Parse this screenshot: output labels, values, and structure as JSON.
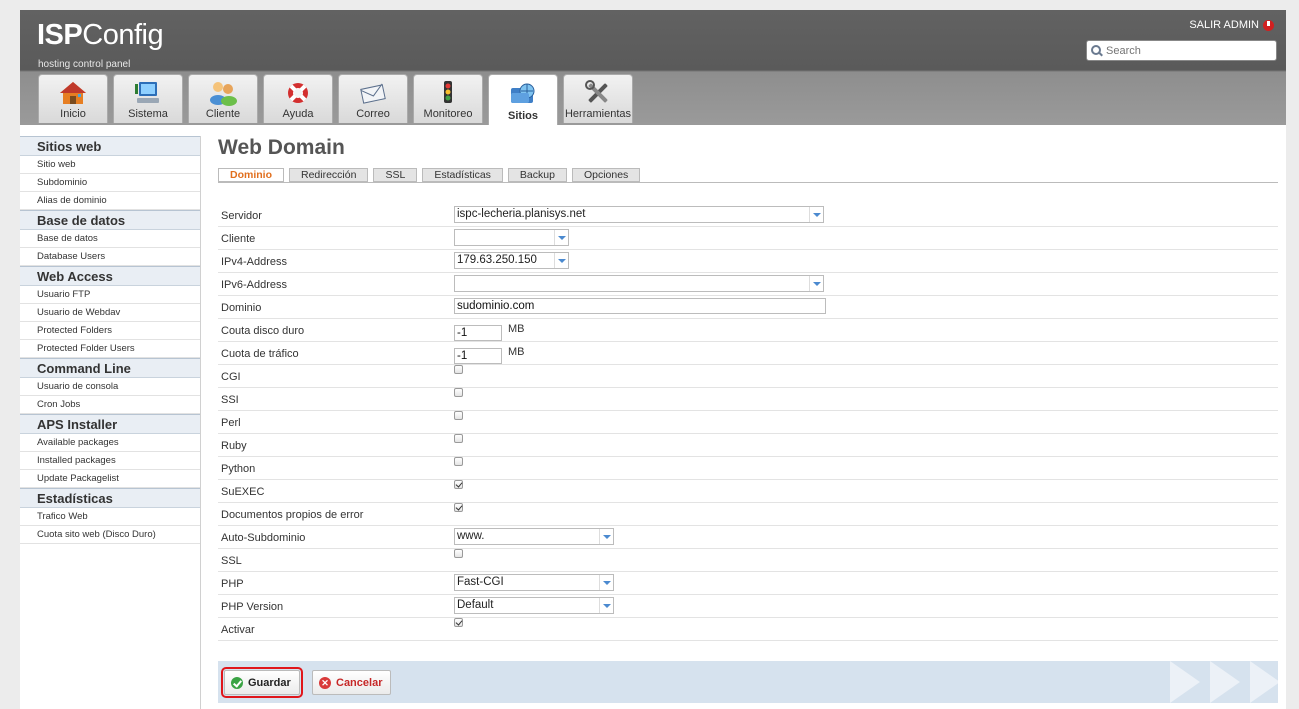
{
  "header": {
    "logo_main": "ISP",
    "logo_rest": "Config",
    "tagline": "hosting control panel",
    "logout_label": "SALIR ADMIN",
    "search_placeholder": "Search"
  },
  "main_tabs": [
    {
      "label": "Inicio",
      "icon": "home-icon"
    },
    {
      "label": "Sistema",
      "icon": "computer-icon"
    },
    {
      "label": "Cliente",
      "icon": "users-icon"
    },
    {
      "label": "Ayuda",
      "icon": "lifebuoy-icon"
    },
    {
      "label": "Correo",
      "icon": "envelope-icon"
    },
    {
      "label": "Monitoreo",
      "icon": "traffic-light-icon"
    },
    {
      "label": "Sitios",
      "icon": "globe-folder-icon",
      "active": true
    },
    {
      "label": "Herramientas",
      "icon": "tools-icon"
    }
  ],
  "sidebar": {
    "sections": [
      {
        "title": "Sitios web",
        "items": [
          "Sitio web",
          "Subdominio",
          "Alias de dominio"
        ]
      },
      {
        "title": "Base de datos",
        "items": [
          "Base de datos",
          "Database Users"
        ]
      },
      {
        "title": "Web Access",
        "items": [
          "Usuario FTP",
          "Usuario de Webdav",
          "Protected Folders",
          "Protected Folder Users"
        ]
      },
      {
        "title": "Command Line",
        "items": [
          "Usuario de consola",
          "Cron Jobs"
        ]
      },
      {
        "title": "APS Installer",
        "items": [
          "Available packages",
          "Installed packages",
          "Update Packagelist"
        ]
      },
      {
        "title": "Estadísticas",
        "items": [
          "Trafico Web",
          "Cuota sito web (Disco Duro)"
        ]
      }
    ]
  },
  "content": {
    "title": "Web Domain",
    "tabs": [
      "Dominio",
      "Redirección",
      "SSL",
      "Estadísticas",
      "Backup",
      "Opciones"
    ],
    "active_tab": "Dominio"
  },
  "form": {
    "servidor": {
      "label": "Servidor",
      "value": "ispc-lecheria.planisys.net"
    },
    "cliente": {
      "label": "Cliente",
      "value": ""
    },
    "ipv4": {
      "label": "IPv4-Address",
      "value": "179.63.250.150"
    },
    "ipv6": {
      "label": "IPv6-Address",
      "value": ""
    },
    "dominio": {
      "label": "Dominio",
      "value": "sudominio.com"
    },
    "cuota_disco": {
      "label": "Couta disco duro",
      "value": "-1",
      "unit": "MB"
    },
    "cuota_trafico": {
      "label": "Cuota de tráfico",
      "value": "-1",
      "unit": "MB"
    },
    "cgi": {
      "label": "CGI",
      "checked": false
    },
    "ssi": {
      "label": "SSI",
      "checked": false
    },
    "perl": {
      "label": "Perl",
      "checked": false
    },
    "ruby": {
      "label": "Ruby",
      "checked": false
    },
    "python": {
      "label": "Python",
      "checked": false
    },
    "suexec": {
      "label": "SuEXEC",
      "checked": true
    },
    "errordocs": {
      "label": "Documentos propios de error",
      "checked": true
    },
    "auto_subdomain": {
      "label": "Auto-Subdominio",
      "value": "www."
    },
    "ssl": {
      "label": "SSL",
      "checked": false
    },
    "php": {
      "label": "PHP",
      "value": "Fast-CGI"
    },
    "php_version": {
      "label": "PHP Version",
      "value": "Default"
    },
    "activar": {
      "label": "Activar",
      "checked": true
    }
  },
  "buttons": {
    "save": "Guardar",
    "cancel": "Cancelar"
  }
}
